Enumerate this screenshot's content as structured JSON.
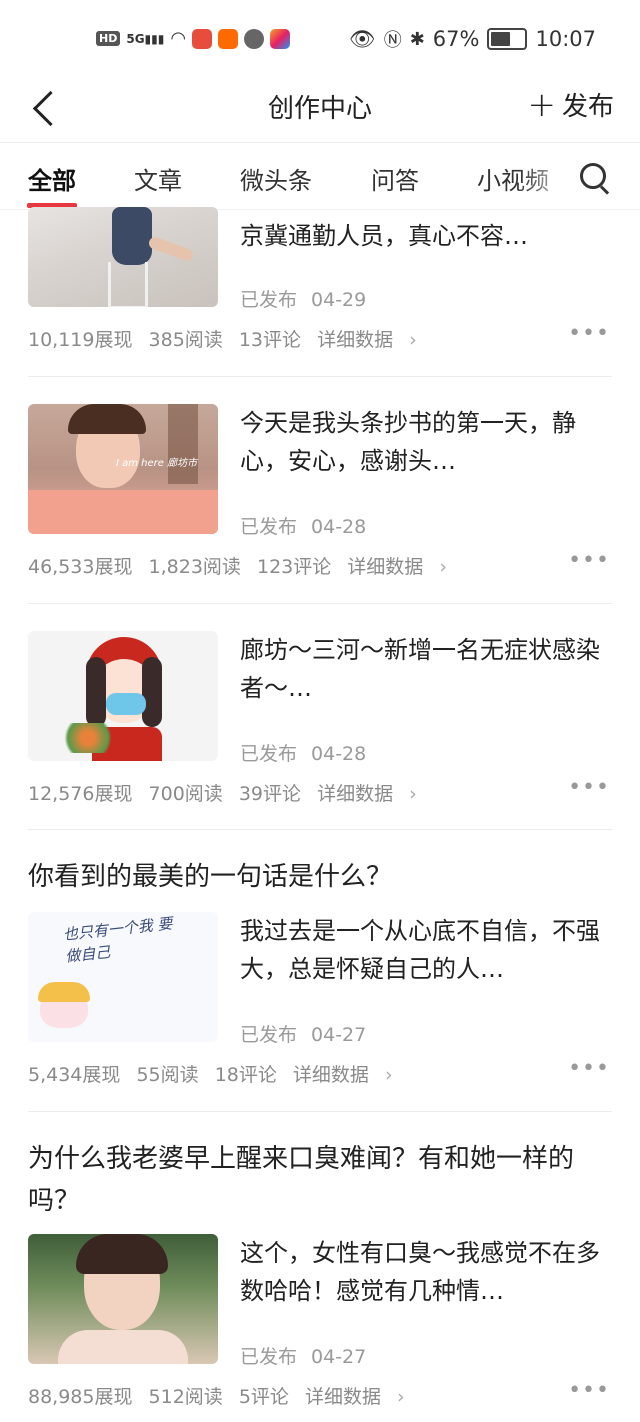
{
  "status_bar": {
    "network": "5G",
    "hd": "HD",
    "battery": "67%",
    "battery_level": 0.67,
    "time": "10:07",
    "icons": [
      "hd-icon",
      "signal-icon",
      "wifi-icon",
      "book-app-icon",
      "taobao-app-icon",
      "audio-app-icon",
      "app-icon",
      "eye-icon",
      "nfc-icon",
      "bluetooth-icon",
      "battery-icon"
    ]
  },
  "header": {
    "title": "创作中心",
    "publish_label": "发布"
  },
  "tabs": [
    {
      "label": "全部",
      "active": true
    },
    {
      "label": "文章",
      "active": false
    },
    {
      "label": "微头条",
      "active": false
    },
    {
      "label": "问答",
      "active": false
    },
    {
      "label": "小视频",
      "active": false
    }
  ],
  "items": [
    {
      "title": "京冀通勤人员，真心不容…",
      "status": "已发布",
      "date": "04-29",
      "views": "10,119展现",
      "reads": "385阅读",
      "comments": "13评论",
      "detail": "详细数据"
    },
    {
      "title": "今天是我头条抄书的第一天，静心，安心，感谢头…",
      "status": "已发布",
      "date": "04-28",
      "views": "46,533展现",
      "reads": "1,823阅读",
      "comments": "123评论",
      "detail": "详细数据",
      "thumb_caption": "I am here 廊坊市"
    },
    {
      "title": "廊坊～三河～新增一名无症状感染者～…",
      "status": "已发布",
      "date": "04-28",
      "views": "12,576展现",
      "reads": "700阅读",
      "comments": "39评论",
      "detail": "详细数据"
    },
    {
      "question": "你看到的最美的一句话是什么？",
      "title": "我过去是一个从心底不自信，不强大，总是怀疑自己的人…",
      "status": "已发布",
      "date": "04-27",
      "views": "5,434展现",
      "reads": "55阅读",
      "comments": "18评论",
      "detail": "详细数据",
      "thumb_text": "也只有一个我 要做自己"
    },
    {
      "question": "为什么我老婆早上醒来口臭难闻？有和她一样的吗？",
      "title": "这个，女性有口臭～我感觉不在多数哈哈！感觉有几种情…",
      "status": "已发布",
      "date": "04-27",
      "views": "88,985展现",
      "reads": "512阅读",
      "comments": "5评论",
      "detail": "详细数据"
    }
  ],
  "colors": {
    "accent": "#e8373f",
    "muted_text": "#8a8a8a",
    "taobao_orange": "#ff6a00"
  }
}
